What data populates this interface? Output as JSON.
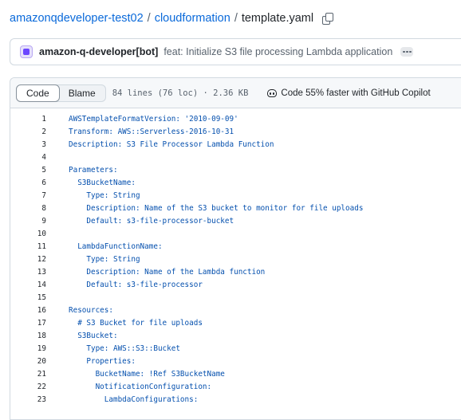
{
  "breadcrumb": {
    "repo": "amazonqdeveloper-test02",
    "separator": "/",
    "folder": "cloudformation",
    "file": "template.yaml"
  },
  "commit": {
    "author": "amazon-q-developer[bot]",
    "message": "feat: Initialize S3 file processing Lambda application"
  },
  "file_header": {
    "code_label": "Code",
    "blame_label": "Blame",
    "meta": "84 lines (76 loc) · 2.36 KB",
    "copilot_label": "Code 55% faster with GitHub Copilot"
  },
  "code_lines": [
    {
      "n": "1",
      "t": "AWSTemplateFormatVersion: '2010-09-09'"
    },
    {
      "n": "2",
      "t": "Transform: AWS::Serverless-2016-10-31"
    },
    {
      "n": "3",
      "t": "Description: S3 File Processor Lambda Function"
    },
    {
      "n": "4",
      "t": ""
    },
    {
      "n": "5",
      "t": "Parameters:"
    },
    {
      "n": "6",
      "t": "  S3BucketName:"
    },
    {
      "n": "7",
      "t": "    Type: String"
    },
    {
      "n": "8",
      "t": "    Description: Name of the S3 bucket to monitor for file uploads"
    },
    {
      "n": "9",
      "t": "    Default: s3-file-processor-bucket"
    },
    {
      "n": "10",
      "t": ""
    },
    {
      "n": "11",
      "t": "  LambdaFunctionName:"
    },
    {
      "n": "12",
      "t": "    Type: String"
    },
    {
      "n": "13",
      "t": "    Description: Name of the Lambda function"
    },
    {
      "n": "14",
      "t": "    Default: s3-file-processor"
    },
    {
      "n": "15",
      "t": ""
    },
    {
      "n": "16",
      "t": "Resources:"
    },
    {
      "n": "17",
      "t": "  # S3 Bucket for file uploads"
    },
    {
      "n": "18",
      "t": "  S3Bucket:"
    },
    {
      "n": "19",
      "t": "    Type: AWS::S3::Bucket"
    },
    {
      "n": "20",
      "t": "    Properties:"
    },
    {
      "n": "21",
      "t": "      BucketName: !Ref S3BucketName"
    },
    {
      "n": "22",
      "t": "      NotificationConfiguration:"
    },
    {
      "n": "23",
      "t": "        LambdaConfigurations:"
    }
  ]
}
